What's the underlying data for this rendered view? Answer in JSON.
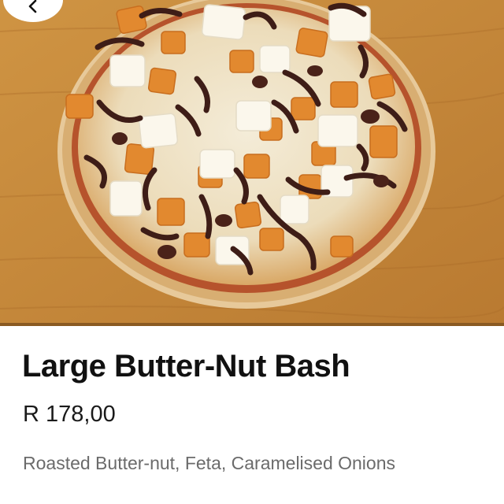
{
  "header": {
    "back_icon": "chevron-left-icon"
  },
  "hero": {
    "image_subject": "pizza-photo"
  },
  "item": {
    "name": "Large Butter-Nut Bash",
    "price": "R 178,00",
    "description": "Roasted Butter-nut, Feta, Caramelised Onions"
  },
  "colors": {
    "title": "#111111",
    "price": "#1a1a1a",
    "description": "#6b6b6b",
    "background": "#ffffff"
  }
}
